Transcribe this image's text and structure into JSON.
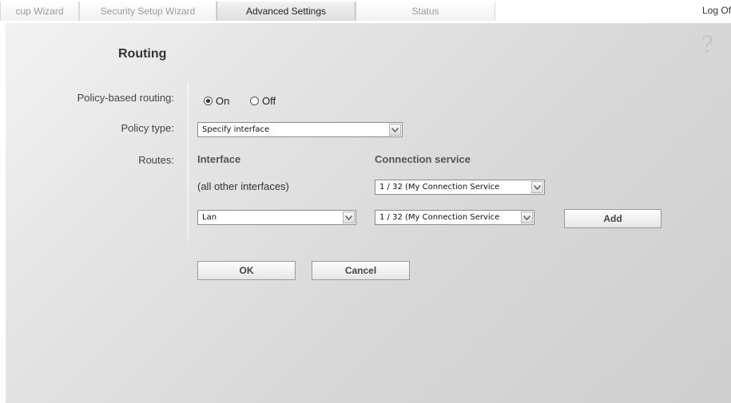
{
  "tabs": [
    {
      "label": "cup Wizard"
    },
    {
      "label": "Security Setup Wizard"
    },
    {
      "label": "Advanced Settings"
    },
    {
      "label": "Status"
    }
  ],
  "logoff_label": "Log Of",
  "help_glyph": "?",
  "page_title": "Routing",
  "policy_routing": {
    "label": "Policy-based routing:",
    "on_label": "On",
    "off_label": "Off",
    "selected": "On"
  },
  "policy_type": {
    "label": "Policy type:",
    "value": "Specify interface"
  },
  "routes": {
    "label": "Routes:",
    "interface_header": "Interface",
    "service_header": "Connection service",
    "default_interface_text": "(all other interfaces)",
    "default_service_value": "1 / 32 (My Connection Service",
    "interface_select_value": "Lan",
    "service_select_value": "1 / 32 (My Connection Service",
    "add_label": "Add"
  },
  "actions": {
    "ok_label": "OK",
    "cancel_label": "Cancel"
  }
}
